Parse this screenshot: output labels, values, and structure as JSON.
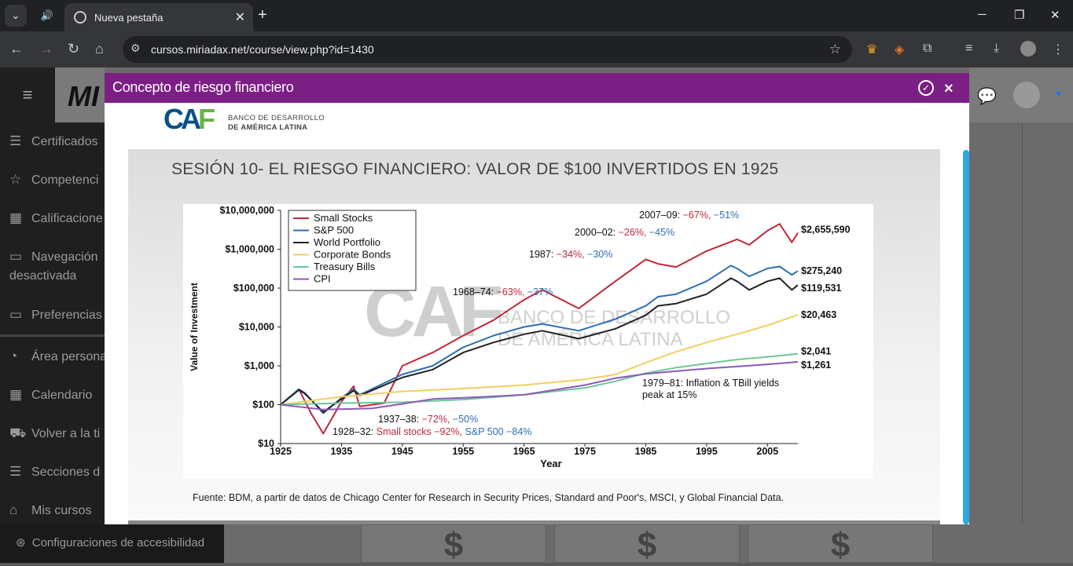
{
  "browser": {
    "tab_title": "Nueva pestaña",
    "url": "cursos.miriadax.net/course/view.php?id=1430",
    "controls": {
      "minimize": "─",
      "restore": "❐",
      "close": "✕",
      "new_tab": "+",
      "tab_close": "✕",
      "audio": "🔊",
      "tab_list": "⌄"
    }
  },
  "sidebar": {
    "menu_icon": "≡",
    "brand": "MI",
    "items": [
      {
        "label": "Certificados",
        "icon": "layers-icon",
        "glyph": "☰"
      },
      {
        "label": "Competenci",
        "icon": "star-icon",
        "glyph": "☆"
      },
      {
        "label": "Calificacione",
        "icon": "table-icon",
        "glyph": "▦"
      },
      {
        "label": "Navegación",
        "label2": "desactivada",
        "icon": "folder-icon",
        "glyph": "▭"
      },
      {
        "label": "Preferencias",
        "icon": "folder-icon",
        "glyph": "▭"
      },
      {
        "label": "Área persona",
        "icon": "dashboard-icon",
        "glyph": "◔"
      },
      {
        "label": "Calendario",
        "icon": "calendar-icon",
        "glyph": "▦"
      },
      {
        "label": "Volver a la ti",
        "icon": "cart-icon",
        "glyph": "⛟"
      },
      {
        "label": "Secciones d",
        "icon": "list-icon",
        "glyph": "☰"
      },
      {
        "label": "Mis cursos",
        "icon": "graduation-cap-icon",
        "glyph": "⌂"
      }
    ],
    "accessibility": "Configuraciones de accesibilidad"
  },
  "cards": [
    "$",
    "$",
    "$"
  ],
  "modal": {
    "title": "Concepto de riesgo financiero",
    "caf_logo": "CAF",
    "caf_line1": "BANCO DE DESARROLLO",
    "caf_line2": "DE AMÉRICA LATINA",
    "slide_title": "SESIÓN 10- EL RIESGO FINANCIERO: VALOR DE $100 INVERTIDOS EN 1925",
    "source": "Fuente: BDM, a partir de datos de Chicago Center for Research in Security Prices, Standard and Poor's, MSCI, y Global Financial Data."
  },
  "chart_data": {
    "type": "line",
    "ylabel": "Value of Investment",
    "xlabel": "Year",
    "x_ticks": [
      "1925",
      "1935",
      "1945",
      "1955",
      "1965",
      "1975",
      "1985",
      "1995",
      "2005"
    ],
    "y_ticks": [
      "$10",
      "$100",
      "$1,000",
      "$10,000",
      "$100,000",
      "$1,000,000",
      "$10,000,000"
    ],
    "y_scale": "log",
    "ylim": [
      10,
      10000000
    ],
    "xlim": [
      1925,
      2010
    ],
    "legend_position": "top-left",
    "series": [
      {
        "name": "Small Stocks",
        "color": "#c0283a",
        "final": "$2,655,590",
        "x": [
          1925,
          1928,
          1930,
          1932,
          1935,
          1937,
          1938,
          1942,
          1945,
          1950,
          1955,
          1960,
          1965,
          1968,
          1974,
          1980,
          1985,
          1987,
          1990,
          1995,
          2000,
          2002,
          2005,
          2007,
          2009,
          2010
        ],
        "y": [
          100,
          250,
          60,
          18,
          120,
          300,
          90,
          110,
          1000,
          2200,
          6000,
          15000,
          50000,
          90000,
          30000,
          150000,
          550000,
          420000,
          350000,
          900000,
          1800000,
          1300000,
          3000000,
          4500000,
          1500000,
          2655590
        ]
      },
      {
        "name": "S&P 500",
        "color": "#2d6fb5",
        "final": "$275,240",
        "x": [
          1925,
          1928,
          1929,
          1932,
          1935,
          1937,
          1938,
          1945,
          1950,
          1955,
          1960,
          1965,
          1968,
          1974,
          1980,
          1985,
          1987,
          1990,
          1995,
          1999,
          2000,
          2002,
          2005,
          2007,
          2009,
          2010
        ],
        "y": [
          100,
          250,
          200,
          60,
          150,
          250,
          180,
          600,
          1000,
          3000,
          6000,
          10000,
          12000,
          8000,
          16000,
          35000,
          60000,
          70000,
          150000,
          380000,
          320000,
          200000,
          320000,
          360000,
          220000,
          275240
        ]
      },
      {
        "name": "World Portfolio",
        "color": "#222222",
        "final": "$119,531",
        "x": [
          1925,
          1928,
          1929,
          1932,
          1935,
          1937,
          1938,
          1945,
          1950,
          1955,
          1960,
          1965,
          1968,
          1974,
          1980,
          1985,
          1987,
          1990,
          1995,
          1999,
          2000,
          2002,
          2005,
          2007,
          2009,
          2010
        ],
        "y": [
          100,
          240,
          190,
          65,
          140,
          230,
          170,
          500,
          800,
          2200,
          4000,
          6500,
          8000,
          5000,
          9000,
          20000,
          35000,
          40000,
          70000,
          180000,
          150000,
          90000,
          150000,
          180000,
          90000,
          119531
        ]
      },
      {
        "name": "Corporate Bonds",
        "color": "#f0d060",
        "final": "$20,463",
        "x": [
          1925,
          1935,
          1945,
          1955,
          1965,
          1975,
          1980,
          1985,
          1990,
          1995,
          2000,
          2005,
          2010
        ],
        "y": [
          100,
          160,
          220,
          260,
          320,
          450,
          600,
          1200,
          2300,
          4000,
          6500,
          11000,
          20463
        ]
      },
      {
        "name": "Treasury Bills",
        "color": "#6dc69a",
        "final": "$2,041",
        "x": [
          1925,
          1935,
          1945,
          1955,
          1965,
          1975,
          1980,
          1985,
          1990,
          1995,
          2000,
          2005,
          2010
        ],
        "y": [
          100,
          110,
          115,
          135,
          180,
          270,
          400,
          650,
          900,
          1150,
          1450,
          1700,
          2041
        ]
      },
      {
        "name": "CPI",
        "color": "#8a5ab5",
        "final": "$1,261",
        "x": [
          1925,
          1932,
          1940,
          1945,
          1950,
          1955,
          1965,
          1975,
          1980,
          1985,
          1990,
          1995,
          2000,
          2005,
          2010
        ],
        "y": [
          100,
          75,
          80,
          105,
          140,
          150,
          180,
          320,
          480,
          620,
          730,
          850,
          960,
          1090,
          1261
        ]
      }
    ],
    "annotations": [
      {
        "text": "2007–09:",
        "red": "−67%,",
        "blue": "−51%"
      },
      {
        "text": "2000–02:",
        "red": "−26%,",
        "blue": "−45%"
      },
      {
        "text": "1987:",
        "red": "−34%,",
        "blue": "−30%"
      },
      {
        "text": "1968–74:",
        "red": "−63%,",
        "blue": "−37%"
      },
      {
        "text": "1937–38:",
        "red": "−72%,",
        "blue": "−50%"
      },
      {
        "text": "1928–32:",
        "red": "Small stocks −92%,",
        "blue": "S&P 500 −84%"
      },
      {
        "text": "1979–81: Inflation & TBill yields",
        "text2": "peak at 15%"
      }
    ],
    "watermark_line1": "BANCO DE DESARROLLO",
    "watermark_line2": "DE AMÉRICA LATINA",
    "watermark_logo": "CAF"
  }
}
